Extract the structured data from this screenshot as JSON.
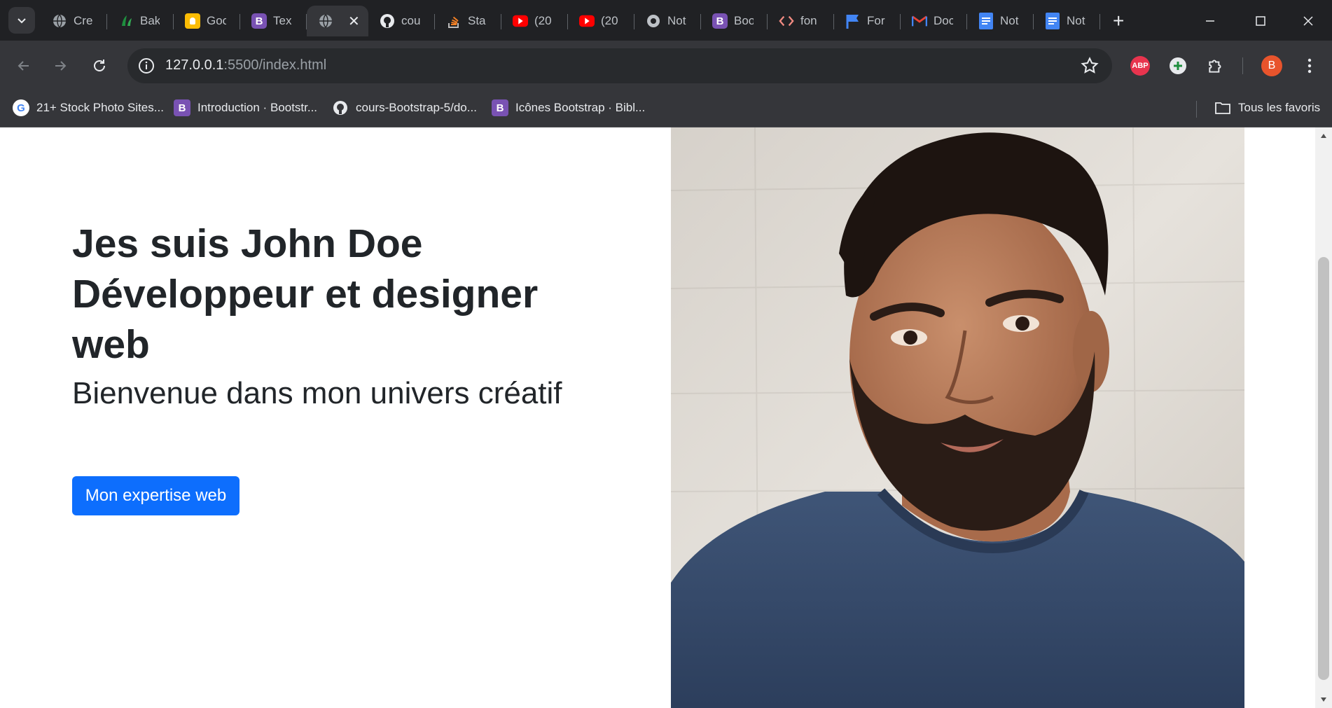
{
  "browser": {
    "tabs": [
      {
        "title": "Cre",
        "icon": "globe-icon",
        "color": "#9aa0a6"
      },
      {
        "title": "Bak",
        "icon": "bakery-icon",
        "color": "#1e8e3e"
      },
      {
        "title": "Goo",
        "icon": "keep-icon",
        "color": "#fbbc04"
      },
      {
        "title": "Tex",
        "icon": "bootstrap-icon",
        "color": "#7952b3"
      },
      {
        "title": "",
        "icon": "globe-icon",
        "color": "#9aa0a6",
        "active": true
      },
      {
        "title": "cou",
        "icon": "github-icon",
        "color": "#e8eaed"
      },
      {
        "title": "Sta",
        "icon": "stackoverflow-icon",
        "color": "#f48024"
      },
      {
        "title": "(20",
        "icon": "youtube-icon",
        "color": "#ff0000"
      },
      {
        "title": "(20",
        "icon": "youtube-icon",
        "color": "#ff0000"
      },
      {
        "title": "Not",
        "icon": "chrome-icon",
        "color": "#bdc1c6"
      },
      {
        "title": "Boo",
        "icon": "bootstrap-icon",
        "color": "#7952b3"
      },
      {
        "title": "fon",
        "icon": "code-icon",
        "color": "#f28b82"
      },
      {
        "title": "For",
        "icon": "flag-icon",
        "color": "#4285f4"
      },
      {
        "title": "Doc",
        "icon": "gmail-icon",
        "color": "#ea4335"
      },
      {
        "title": "Not",
        "icon": "docs-icon",
        "color": "#4285f4"
      },
      {
        "title": "Not",
        "icon": "docs-icon",
        "color": "#4285f4"
      }
    ],
    "new_tab": "+",
    "active_close": "✕",
    "address": {
      "host": "127.0.0.1",
      "path": ":5500/index.html"
    },
    "extensions": {
      "abp": "ABP",
      "profile": "B"
    },
    "bookmarks": [
      {
        "label": "21+ Stock Photo Sites...",
        "icon": "google-icon"
      },
      {
        "label": "Introduction · Bootstr...",
        "icon": "bootstrap-icon"
      },
      {
        "label": "cours-Bootstrap-5/do...",
        "icon": "github-icon"
      },
      {
        "label": "Icônes Bootstrap · Bibl...",
        "icon": "bootstrap-icon"
      }
    ],
    "all_bookmarks": "Tous les favoris"
  },
  "page": {
    "title_line1": "Jes suis John Doe",
    "title_line2": "Développeur et designer",
    "title_line3": "web",
    "subtitle": "Bienvenue dans mon univers créatif",
    "cta": "Mon expertise web",
    "accent": "#0d6efd",
    "photo_alt": "Portrait photo"
  }
}
